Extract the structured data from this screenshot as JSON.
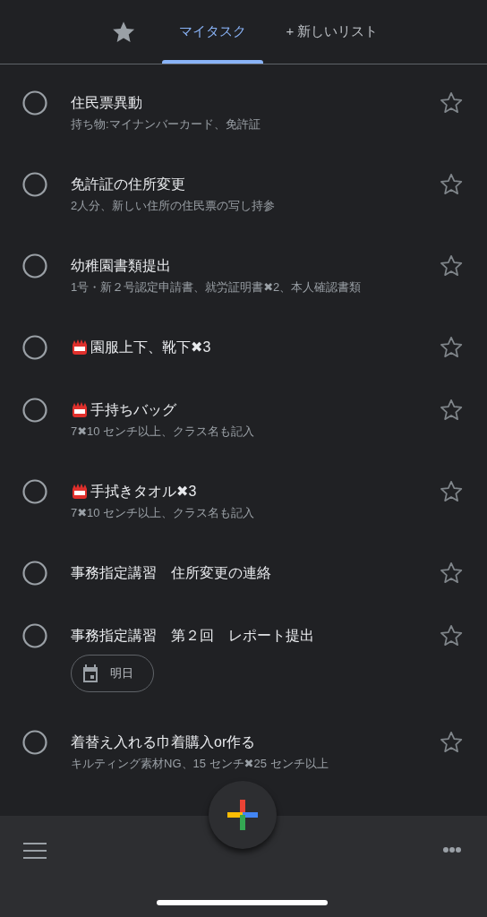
{
  "tabs": [
    {
      "kind": "starred",
      "selected": false
    },
    {
      "kind": "list",
      "label": "マイタスク",
      "selected": true
    },
    {
      "kind": "new",
      "label": "+ 新しいリスト",
      "selected": false
    }
  ],
  "tasks": [
    {
      "kind": "plain",
      "title": "住民票異動",
      "notes": "持ち物:マイナンバーカード、免許証",
      "completed": false,
      "starred": false
    },
    {
      "kind": "plain",
      "title": "免許証の住所変更",
      "notes": "2人分、新しい住所の住民票の写し持参",
      "completed": false,
      "starred": false
    },
    {
      "kind": "plain",
      "title": "幼稚園書類提出",
      "notes": "1号・新２号認定申請書、就労証明書✖2、本人確認書類",
      "completed": false,
      "starred": false
    },
    {
      "kind": "badge",
      "title": "園服上下、靴下✖3",
      "completed": false,
      "starred": false
    },
    {
      "kind": "badge",
      "title": "手持ちバッグ",
      "notes": "7✖10 センチ以上、クラス名も記入",
      "completed": false,
      "starred": false
    },
    {
      "kind": "badge",
      "title": "手拭きタオル✖3",
      "notes": "7✖10 センチ以上、クラス名も記入",
      "completed": false,
      "starred": false
    },
    {
      "kind": "plain",
      "title": "事務指定講習　住所変更の連絡",
      "completed": false,
      "starred": false
    },
    {
      "kind": "plain",
      "title": "事務指定講習　第２回　レポート提出",
      "due": "明日",
      "completed": false,
      "starred": false
    },
    {
      "kind": "plain",
      "title": "着替え入れる巾着購入or作る",
      "notes": "キルティング素材NG、15 センチ✖25 センチ以上",
      "completed": false,
      "starred": false
    }
  ]
}
